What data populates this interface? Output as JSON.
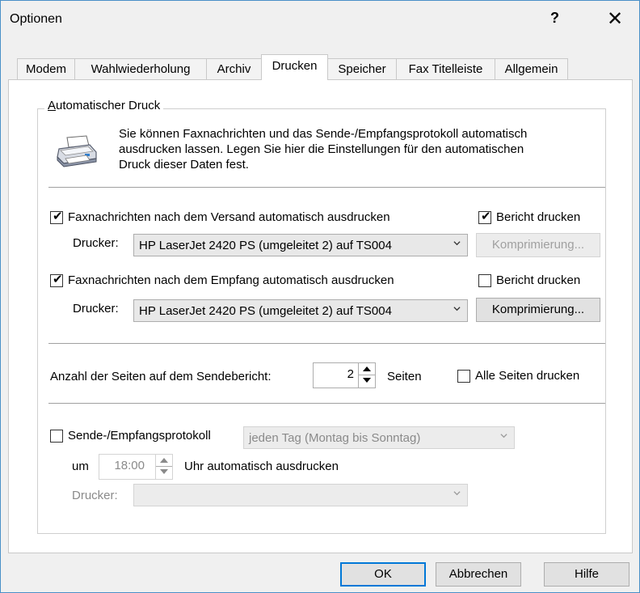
{
  "window": {
    "title": "Optionen",
    "help": "?",
    "close": "✕"
  },
  "tabs": [
    {
      "label": "Modem"
    },
    {
      "label": "Wahlwiederholung"
    },
    {
      "label": "Archiv"
    },
    {
      "label": "Drucken"
    },
    {
      "label": "Speicher"
    },
    {
      "label": "Fax Titelleiste"
    },
    {
      "label": "Allgemein"
    }
  ],
  "active_tab": "Drucken",
  "group": {
    "title_prefix": "A",
    "title_rest": "utomatischer Druck",
    "description_lines": [
      "Sie können Faxnachrichten und das Sende-/Empfangsprotokoll automatisch",
      "ausdrucken lassen. Legen Sie hier die Einstellungen für den automatischen",
      "Druck dieser Daten fest."
    ]
  },
  "send": {
    "checkbox_label": "Faxnachrichten nach dem Versand automatisch ausdrucken",
    "checked": true,
    "report_label": "Bericht drucken",
    "report_checked": true,
    "printer_label": "Drucker:",
    "printer_value": "HP LaserJet 2420 PS (umgeleitet 2) auf TS004",
    "compress_label": "Komprimierung..."
  },
  "receive": {
    "checkbox_label": "Faxnachrichten nach dem Empfang automatisch ausdrucken",
    "checked": true,
    "report_label": "Bericht drucken",
    "report_checked": false,
    "printer_label": "Drucker:",
    "printer_value": "HP LaserJet 2420 PS (umgeleitet 2) auf TS004",
    "compress_label": "Komprimierung..."
  },
  "pages": {
    "label": "Anzahl der Seiten auf dem Sendebericht:",
    "value": "2",
    "unit": "Seiten",
    "all_label": "Alle Seiten drucken",
    "all_checked": false
  },
  "protocol": {
    "checkbox_label": "Sende-/Empfangsprotokoll",
    "checked": false,
    "schedule_value": "jeden Tag (Montag bis Sonntag)",
    "at_label": "um",
    "time_value": "18:00",
    "time_suffix": "Uhr automatisch ausdrucken",
    "printer_label": "Drucker:",
    "printer_value": ""
  },
  "buttons": {
    "ok": "OK",
    "cancel": "Abbrechen",
    "help": "Hilfe"
  },
  "colors": {
    "accent": "#0078d7",
    "window_border": "#4a90c8",
    "disabled_text": "#8a8a8a"
  }
}
